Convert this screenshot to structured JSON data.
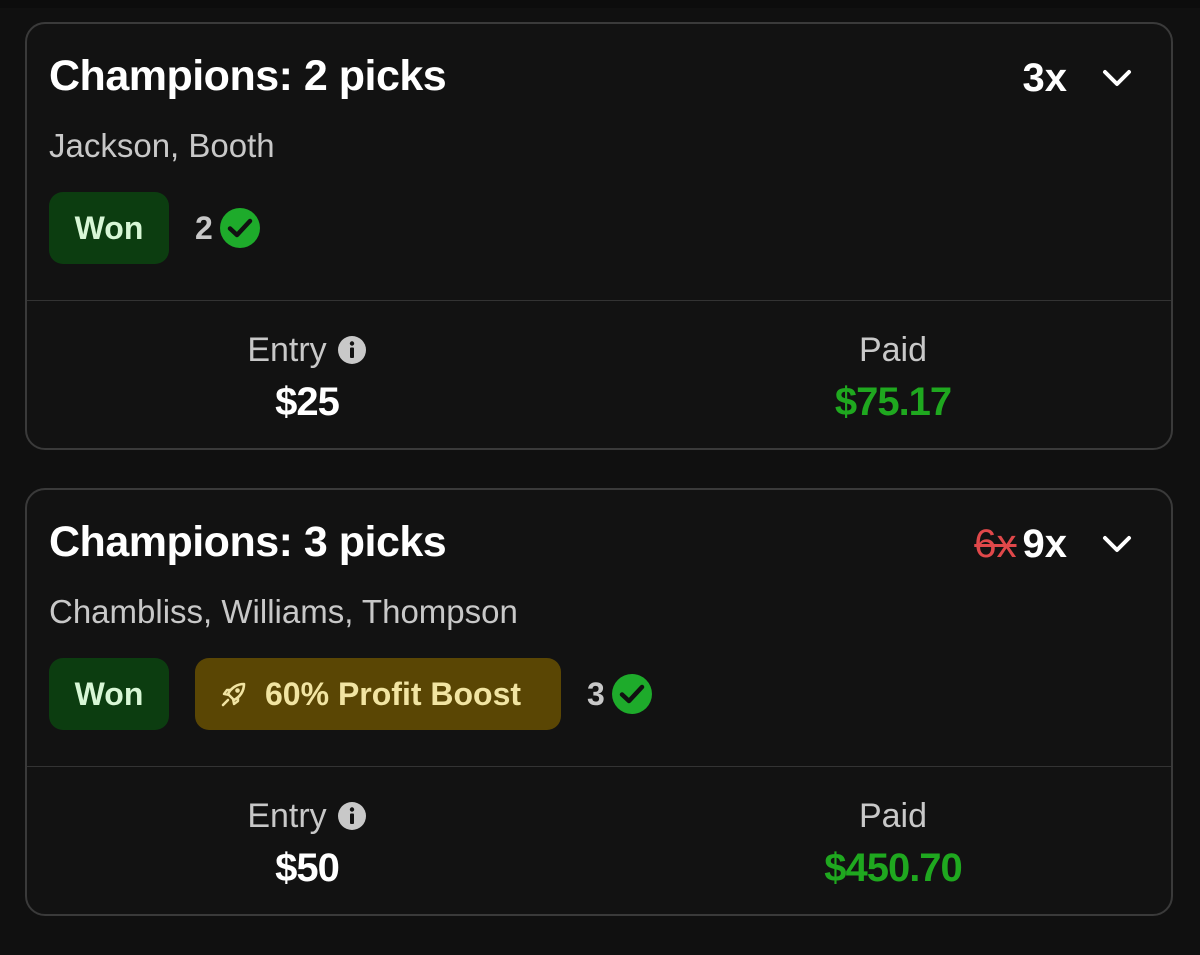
{
  "entries": [
    {
      "title": "Champions: 2 picks",
      "multiplier_old": "",
      "multiplier": "3x",
      "players": "Jackson, Booth",
      "status": "Won",
      "boost": "",
      "correct_count": "2",
      "entry_label": "Entry",
      "entry_value": "$25",
      "paid_label": "Paid",
      "paid_value": "$75.17"
    },
    {
      "title": "Champions: 3 picks",
      "multiplier_old": "6x",
      "multiplier": "9x",
      "players": "Chambliss, Williams, Thompson",
      "status": "Won",
      "boost": "60% Profit Boost",
      "correct_count": "3",
      "entry_label": "Entry",
      "entry_value": "$50",
      "paid_label": "Paid",
      "paid_value": "$450.70"
    }
  ],
  "icons": {
    "chevron": "chevron-down-icon",
    "check": "check-circle-icon",
    "info": "info-icon",
    "rocket": "rocket-icon"
  },
  "colors": {
    "background": "#101010",
    "won_badge_bg": "#0c3d10",
    "boost_badge_bg": "#5a4604",
    "paid_green": "#1fa81f",
    "check_green": "#1eab2b",
    "strike_red": "#e0484a"
  }
}
